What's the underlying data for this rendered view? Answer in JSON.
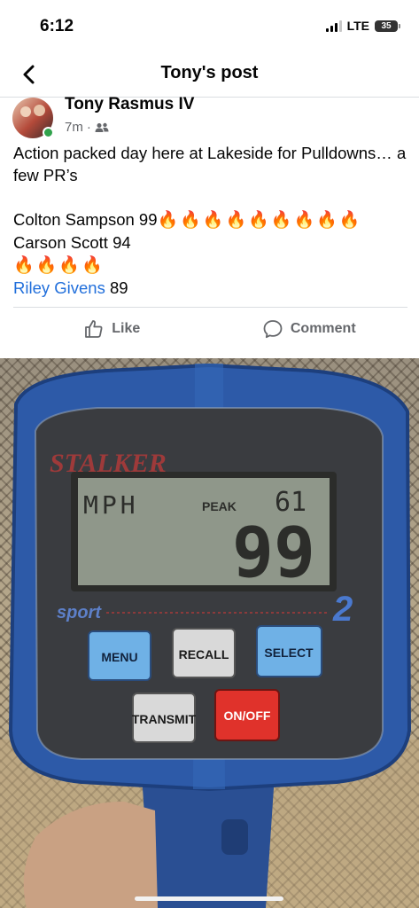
{
  "status_bar": {
    "time": "6:12",
    "network": "LTE",
    "battery": "35"
  },
  "nav": {
    "title": "Tony's post",
    "back_icon": "chevron-left-icon"
  },
  "post": {
    "author": "Tony Rasmus IV",
    "time": "7m",
    "separator": "·",
    "audience_icon": "friends-icon",
    "lines": [
      "Action packed day here at Lakeside for Pulldowns… a few PR’s",
      "",
      "Colton Sampson 99",
      "Carson Scott 94",
      "Riley Givens 89"
    ],
    "entries": [
      {
        "name": "Colton Sampson",
        "value": "99",
        "emoji": "🔥🔥🔥🔥🔥🔥🔥🔥🔥"
      },
      {
        "name": "Carson Scott",
        "value": "94",
        "emoji": "🔥🔥🔥🔥"
      },
      {
        "name": "Riley Givens",
        "value": "89",
        "emoji": ""
      }
    ],
    "intro": "Action packed day here at Lakeside for Pulldowns… a few PR’s"
  },
  "actions": {
    "like": "Like",
    "comment": "Comment"
  },
  "photo": {
    "brand": "STALKER",
    "model": "sport",
    "model_number": "2",
    "lcd": {
      "unit": "MPH",
      "mode": "PEAK",
      "small_reading": "61",
      "large_reading": "99"
    },
    "buttons": {
      "menu": "MENU",
      "recall": "RECALL",
      "select": "SELECT",
      "transmit": "TRANSMIT",
      "power": "ON/OFF"
    },
    "colors": {
      "body": "#2d5aa8",
      "lcd": "#8f978a",
      "button_blue": "#6fb1e6",
      "button_gray": "#d9d9d9",
      "button_red": "#e0322b"
    }
  }
}
